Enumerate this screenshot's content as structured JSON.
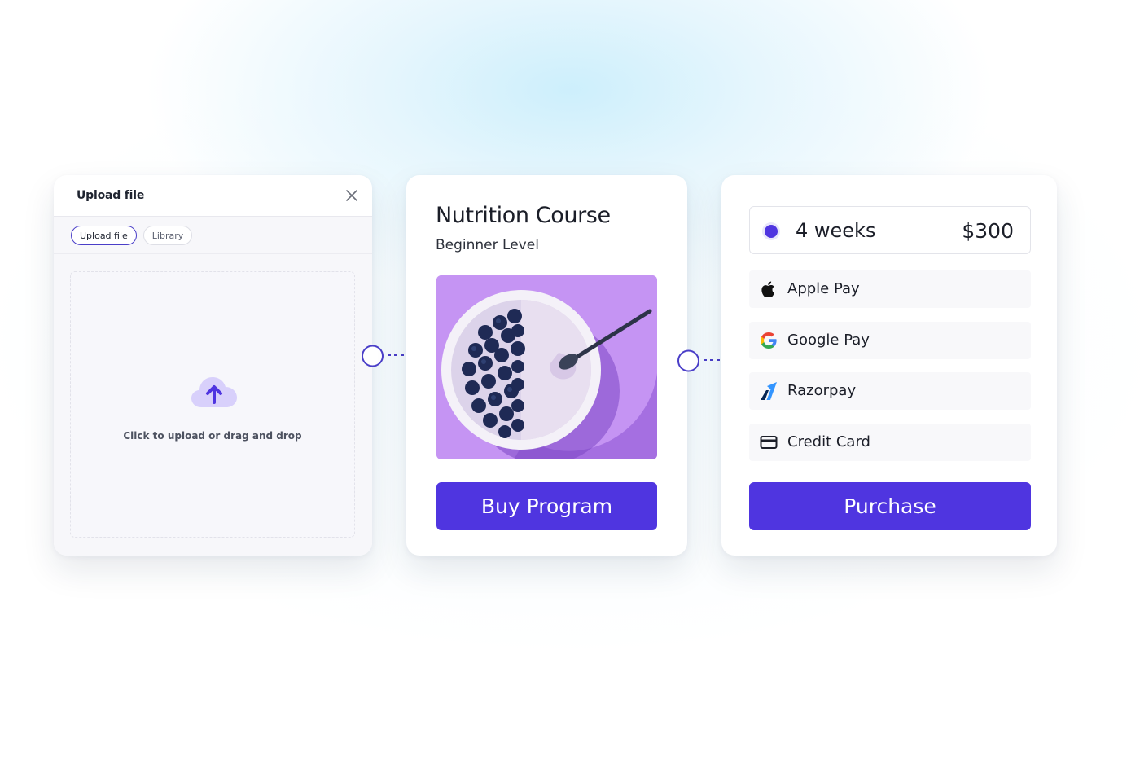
{
  "upload": {
    "title": "Upload file",
    "tabs": [
      {
        "label": "Upload file",
        "active": true
      },
      {
        "label": "Library",
        "active": false
      }
    ],
    "dropzone_text": "Click to upload or drag and drop"
  },
  "course": {
    "title": "Nutrition Course",
    "subtitle": "Beginner Level",
    "buy_label": "Buy Program"
  },
  "payment": {
    "plan": {
      "name": "4 weeks",
      "price": "$300",
      "selected": true
    },
    "options": [
      {
        "label": "Apple Pay",
        "icon": "apple-icon"
      },
      {
        "label": "Google Pay",
        "icon": "google-icon"
      },
      {
        "label": "Razorpay",
        "icon": "razorpay-icon"
      },
      {
        "label": "Credit Card",
        "icon": "credit-card-icon"
      }
    ],
    "purchase_label": "Purchase"
  },
  "colors": {
    "accent": "#4f35e0",
    "image_background": "#c594f3"
  }
}
